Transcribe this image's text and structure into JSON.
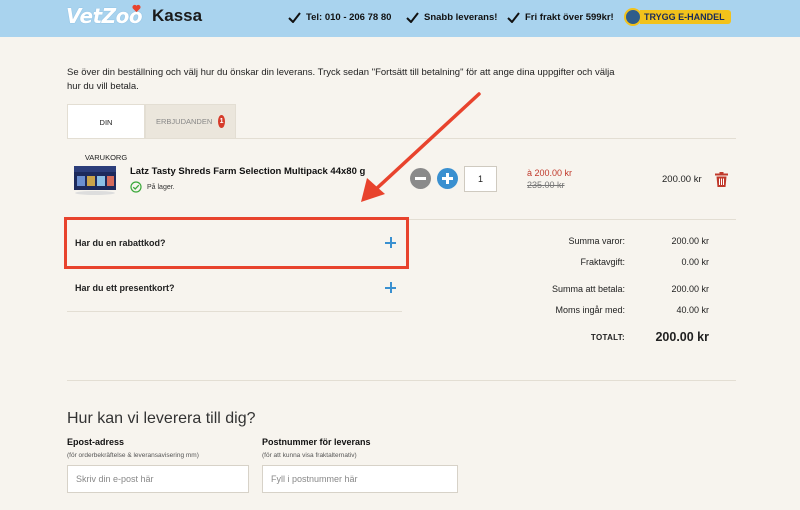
{
  "header": {
    "logo": "VetZoo",
    "title": "Kassa",
    "usps": [
      "Tel: 010 - 206 78 80",
      "Snabb leverans!",
      "Fri frakt över 599kr!"
    ],
    "trust_badge": "TRYGG E-HANDEL"
  },
  "intro": "Se över din beställning och välj hur du önskar din leverans. Tryck sedan \"Fortsätt till betalning\" för att ange dina uppgifter och välja hur du vill betala.",
  "tabs": [
    {
      "label": "DIN VARUKORG",
      "active": true
    },
    {
      "label": "ERBJUDANDEN",
      "badge": "1",
      "active": false
    }
  ],
  "cart": {
    "item": {
      "name": "Latz Tasty Shreds Farm Selection Multipack 44x80 g",
      "stock": "På lager.",
      "quantity": "1",
      "price_each": "à 200.00 kr",
      "price_old": "235.00 kr",
      "line_total": "200.00 kr"
    }
  },
  "accordions": {
    "discount": "Har du en rabattkod?",
    "giftcard": "Har du ett presentkort?"
  },
  "summary": {
    "rows": [
      {
        "label": "Summa varor:",
        "value": "200.00 kr"
      },
      {
        "label": "Fraktavgift:",
        "value": "0.00 kr"
      },
      {
        "label": "Summa att betala:",
        "value": "200.00 kr"
      },
      {
        "label": "Moms ingår med:",
        "value": "40.00 kr"
      }
    ],
    "total_label": "TOTALT:",
    "total_value": "200.00 kr"
  },
  "delivery": {
    "title": "Hur kan vi leverera till dig?",
    "email": {
      "label": "Epost-adress",
      "hint": "(för orderbekräftelse & leveransavisering mm)",
      "placeholder": "Skriv din e-post här"
    },
    "postcode": {
      "label": "Postnummer för leverans",
      "hint": "(för att kunna visa fraktalternativ)",
      "placeholder": "Fyll i postnummer här"
    }
  },
  "colors": {
    "header_bg": "#a9d3ee",
    "accent_blue": "#3a90d0",
    "highlight_red": "#e8432d",
    "price_red": "#c0392b",
    "background": "#f7f4ee"
  }
}
